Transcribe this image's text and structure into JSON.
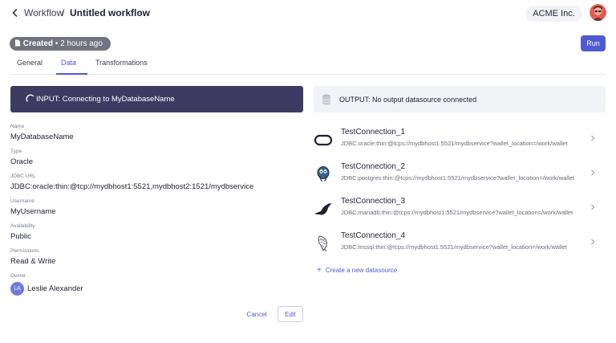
{
  "header": {
    "breadcrumb_parent": "Workflow",
    "breadcrumb_separator": "/",
    "breadcrumb_title": "Untitled workflow",
    "org_name": "ACME Inc."
  },
  "status": {
    "created_label": "Created",
    "created_time": "2 hours ago"
  },
  "toolbar": {
    "run_label": "Run"
  },
  "tabs": [
    {
      "label": "General",
      "active": false
    },
    {
      "label": "Data",
      "active": true
    },
    {
      "label": "Transformations",
      "active": false
    }
  ],
  "input": {
    "banner": "INPUT: Connecting to MyDatabaseName",
    "fields": [
      {
        "label": "Name",
        "value": "MyDatabaseName"
      },
      {
        "label": "Type",
        "value": "Oracle"
      },
      {
        "label": "JDBC URL",
        "value": "JDBC:oracle:thin:@tcp://mydbhost1:5521,mydbhost2:1521/mydbservice"
      },
      {
        "label": "Username",
        "value": "MyUsername"
      },
      {
        "label": "Availability",
        "value": "Public"
      },
      {
        "label": "Permissions",
        "value": "Read & Write"
      }
    ],
    "owner_label": "Owner",
    "owner_initials": "LA",
    "owner_name": "Leslie Alexander",
    "cancel_label": "Cancel",
    "edit_label": "Edit"
  },
  "output": {
    "banner": "OUTPUT: No output datasource connected",
    "connections": [
      {
        "name": "TestConnection_1",
        "url": "JDBC:oracle:thin:@tcps://mydbhost1:5521/mydbservice?wallet_location=/work/wallet",
        "icon": "oracle-icon"
      },
      {
        "name": "TestConnection_2",
        "url": "JDBC:postgres:thin:@tcps://mydbhost1:5521/mydbservice?wallet_location=/work/wallet",
        "icon": "postgres-icon"
      },
      {
        "name": "TestConnection_3",
        "url": "JDBC:mariadb:thin:@tcps://mydbhost1:5521/mydbservice?wallet_location=/work/wallet",
        "icon": "mariadb-icon"
      },
      {
        "name": "TestConnection_4",
        "url": "JDBC:mssql:thin:@tcps://mydbhost1:5521/mydbservice?wallet_location=/work/wallet",
        "icon": "mssql-icon"
      }
    ],
    "create_label": "Create a new datasource"
  },
  "colors": {
    "accent": "#4f5bd5",
    "input_banner": "#3d3b61",
    "output_banner": "#f2f3f6",
    "created_pill": "#737380"
  }
}
